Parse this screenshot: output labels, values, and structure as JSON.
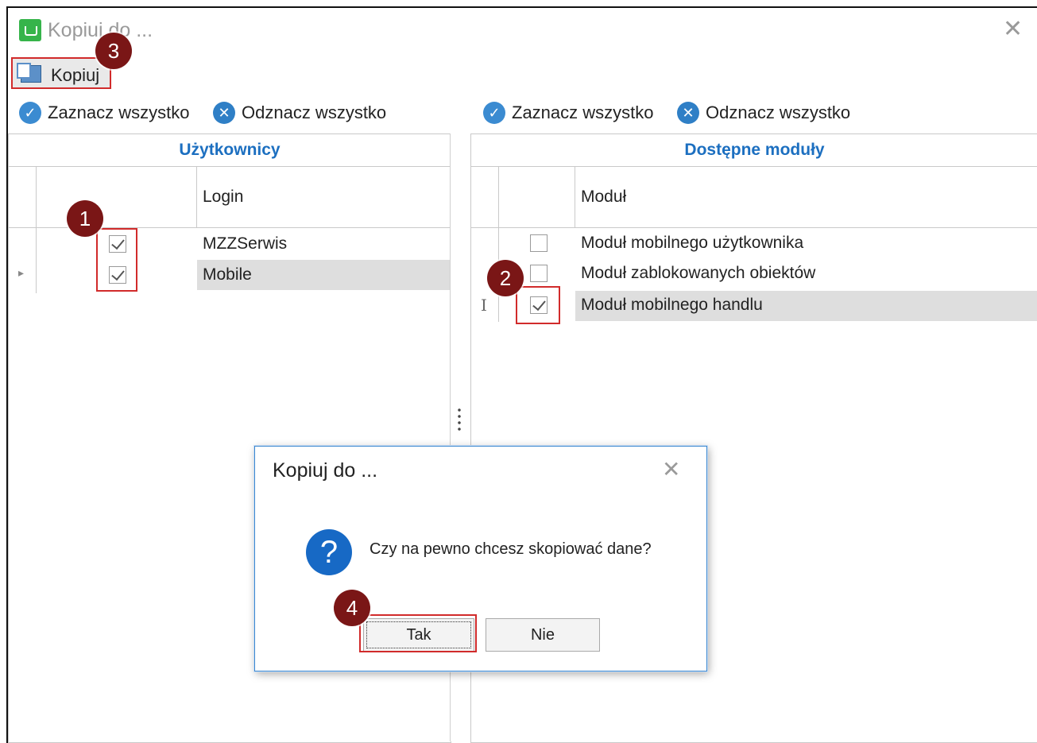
{
  "window": {
    "title": "Kopiuj do ...",
    "close_icon": "close-icon"
  },
  "toolbar": {
    "copy_label": "Kopiuj"
  },
  "left_actions": {
    "select_all": "Zaznacz wszystko",
    "deselect_all": "Odznacz wszystko"
  },
  "right_actions": {
    "select_all": "Zaznacz wszystko",
    "deselect_all": "Odznacz wszystko"
  },
  "users_panel": {
    "header": "Użytkownicy",
    "column": "Login",
    "rows": [
      {
        "login": "MZZSerwis",
        "checked": true
      },
      {
        "login": "Mobile",
        "checked": true,
        "selected": true
      }
    ]
  },
  "modules_panel": {
    "header": "Dostępne moduły",
    "column": "Moduł",
    "rows": [
      {
        "name": "Moduł mobilnego użytkownika",
        "checked": false
      },
      {
        "name": "Moduł zablokowanych obiektów",
        "checked": false
      },
      {
        "name": "Moduł mobilnego handlu",
        "checked": true,
        "selected": true
      }
    ]
  },
  "badges": [
    "1",
    "2",
    "3",
    "4"
  ],
  "dialog": {
    "title": "Kopiuj do ...",
    "message": "Czy na pewno chcesz skopiować dane?",
    "yes": "Tak",
    "no": "Nie",
    "question_mark": "?"
  },
  "colors": {
    "accent": "#1c6fc0",
    "highlight": "#d12b2b",
    "badge": "#7a1616",
    "selection": "#dedede"
  }
}
